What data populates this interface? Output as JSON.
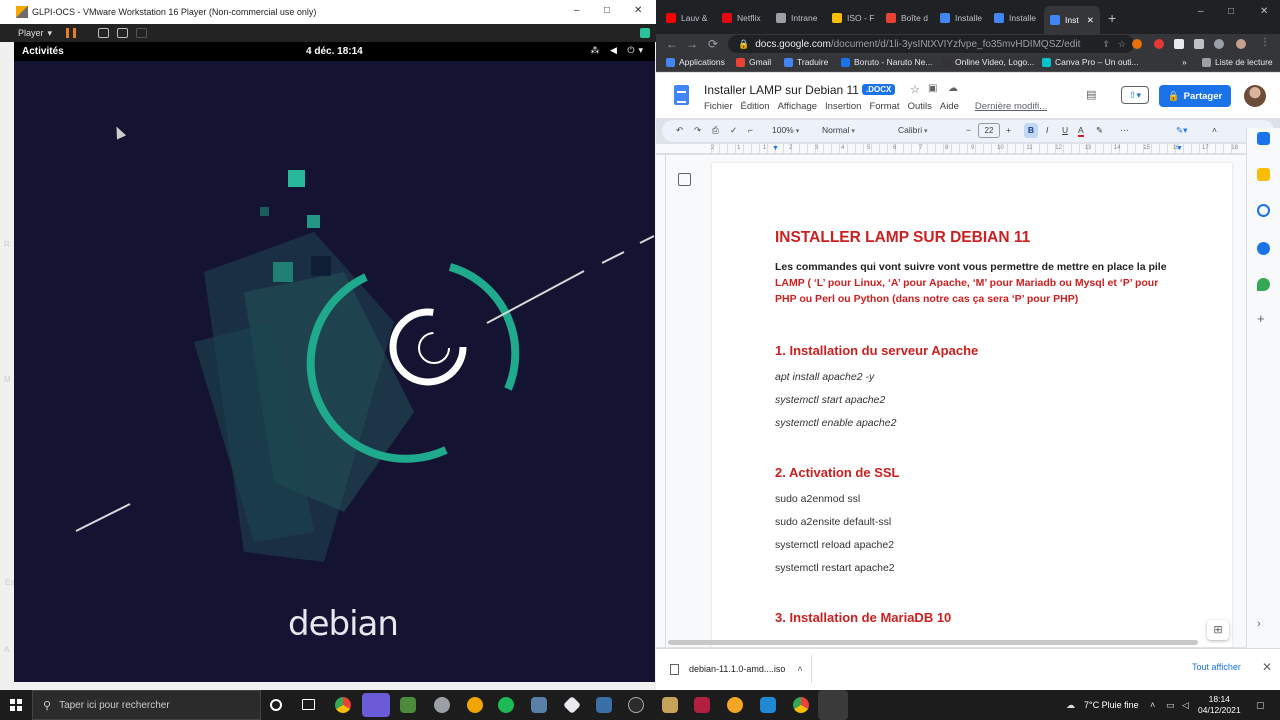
{
  "vmware": {
    "title": "GLPI-OCS - VMware Workstation 16 Player (Non-commercial use only)",
    "player_menu": "Player",
    "controls": [
      "–",
      "□",
      "✕"
    ]
  },
  "guest": {
    "activities": "Activités",
    "clock": "4 déc.  18:14",
    "logo_text": "debian",
    "side_letters": [
      "R",
      "M",
      "Es",
      "A"
    ]
  },
  "chrome": {
    "tabs": [
      {
        "label": "Lauv &",
        "color": "#ff0000"
      },
      {
        "label": "Netflix",
        "color": "#e50914"
      },
      {
        "label": "Intrane",
        "color": "#9aa0a6"
      },
      {
        "label": "ISO - F",
        "color": "#fbbc04"
      },
      {
        "label": "Boîte d",
        "color": "#ea4335"
      },
      {
        "label": "Installe",
        "color": "#4285f4"
      },
      {
        "label": "Installe",
        "color": "#4285f4"
      },
      {
        "label": "Inst",
        "color": "#4285f4",
        "active": true
      }
    ],
    "url_host": "docs.google.com",
    "url_path": "/document/d/1li-3ysINtXVIYzfvpe_fo35mvHDIMQSZ/edit",
    "bookmarks": [
      {
        "label": "Applications",
        "color": "#4285f4"
      },
      {
        "label": "Gmail",
        "color": "#ea4335"
      },
      {
        "label": "Traduire",
        "color": "#4285f4"
      },
      {
        "label": "Boruto - Naruto Ne...",
        "color": "#1a73e8"
      },
      {
        "label": "Online Video, Logo...",
        "color": "#333"
      },
      {
        "label": "Canva Pro – Un outi...",
        "color": "#00c4cc"
      }
    ],
    "reading_list": "Liste de lecture"
  },
  "docs": {
    "title": "Installer LAMP sur Debian 11",
    "badge": ".DOCX",
    "menus": [
      "Fichier",
      "Édition",
      "Affichage",
      "Insertion",
      "Format",
      "Outils",
      "Aide"
    ],
    "last_edit": "Dernière modifi...",
    "share": "Partager",
    "toolbar": {
      "zoom": "100%",
      "style": "Normal",
      "font": "Calibri",
      "font_size": "22"
    },
    "ruler_numbers": [
      "2",
      "1",
      "1",
      "2",
      "3",
      "4",
      "5",
      "6",
      "7",
      "8",
      "9",
      "10",
      "11",
      "12",
      "13",
      "14",
      "15",
      "16",
      "17",
      "18"
    ],
    "content": {
      "heading": "INSTALLER LAMP SUR DEBIAN 11",
      "intro_lines": [
        "Les commandes qui vont suivre vont vous permettre de mettre en place la pile",
        "LAMP ( ‘L’ pour Linux, ‘A’ pour Apache, ‘M’ pour Mariadb ou Mysql et ‘P’ pour",
        "PHP ou Perl ou Python (dans notre cas ça sera ‘P’ pour PHP)"
      ],
      "sections": [
        {
          "title": "1. Installation du serveur Apache",
          "italic": true,
          "commands": [
            "apt install apache2 -y",
            "systemctl start apache2",
            "systemctl enable apache2"
          ]
        },
        {
          "title": "2. Activation de SSL",
          "italic": false,
          "commands": [
            "sudo a2enmod ssl",
            "sudo a2ensite default-ssl",
            "systemctl reload apache2",
            "systemctl restart apache2"
          ]
        },
        {
          "title": "3. Installation de MariaDB 10",
          "italic": false,
          "commands": []
        }
      ]
    }
  },
  "downloads": {
    "file": "debian-11.1.0-amd....iso",
    "show_all": "Tout afficher"
  },
  "taskbar": {
    "search_placeholder": "Taper ici pour rechercher",
    "weather": "7°C  Pluie fine",
    "time": "18:14",
    "date": "04/12/2021"
  }
}
